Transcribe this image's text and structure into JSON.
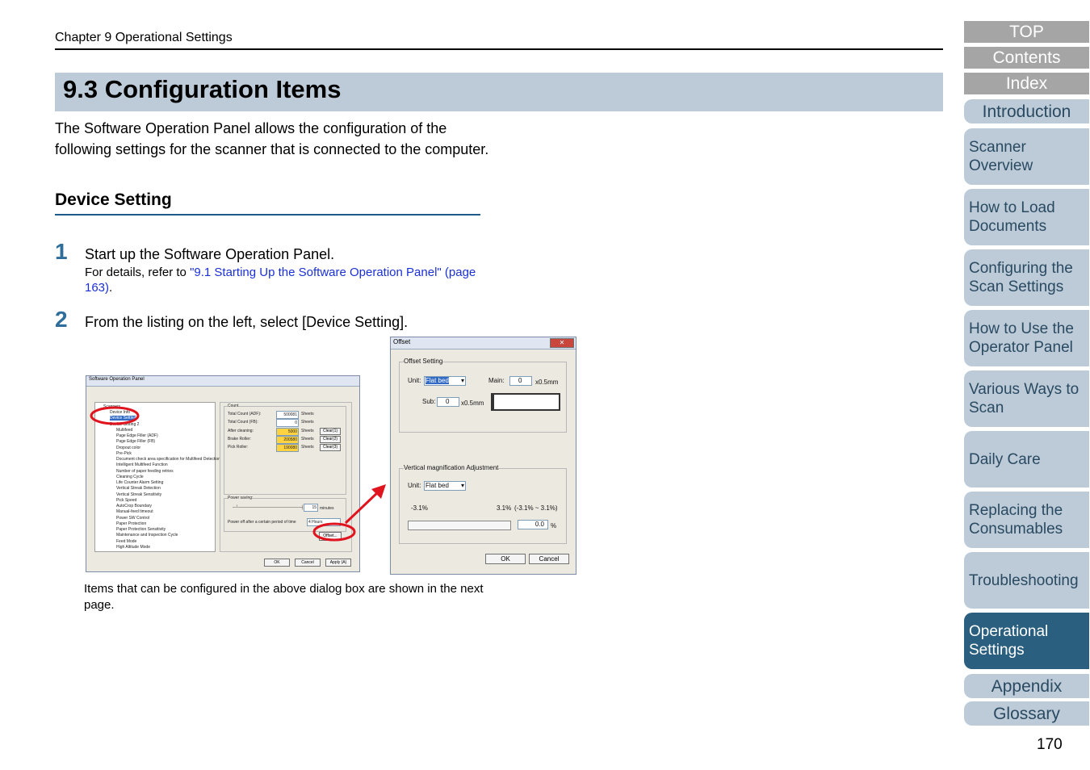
{
  "header": {
    "chapter": "Chapter 9 Operational Settings"
  },
  "title": "9.3 Configuration Items",
  "intro": "The Software Operation Panel allows the configuration of the following settings for the scanner that is connected to the computer.",
  "section": "Device Setting",
  "steps": [
    {
      "num": "1",
      "text": "Start up the Software Operation Panel.",
      "sub_prefix": "For details, refer to ",
      "sub_link": "\"9.1 Starting Up the Software Operation Panel\" (page 163)",
      "sub_suffix": "."
    },
    {
      "num": "2",
      "text": "From the listing on the left, select [Device Setting]."
    }
  ],
  "caption": "Items that can be configured in the above dialog box are shown in the next page.",
  "page_number": "170",
  "sidebar": {
    "top": "TOP",
    "contents": "Contents",
    "index": "Index",
    "tabs": [
      "Introduction",
      "Scanner Overview",
      "How to Load Documents",
      "Configuring the Scan Settings",
      "How to Use the Operator Panel",
      "Various Ways to Scan",
      "Daily Care",
      "Replacing the Consumables",
      "Troubleshooting",
      "Operational Settings",
      "Appendix",
      "Glossary"
    ]
  },
  "dialog1": {
    "title": "Software Operation Panel",
    "tree": [
      "Device Info",
      "Device Setting",
      "Device Setting 2",
      "Multifeed",
      "Page Edge Filler (ADF)",
      "Page Edge Filler (FB)",
      "Dropout color",
      "Pre-Pick",
      "Document check area specification for Multifeed Detection",
      "Intelligent Multifeed Function",
      "Number of paper feeding retries",
      "Cleaning Cycle",
      "Life Counter Alarm Setting",
      "Vertical Streak Detection",
      "Vertical Streak Sensitivity",
      "Pick Speed",
      "AutoCrop Boundary",
      "Manual-feed timeout",
      "Power SW Control",
      "Paper Protection",
      "Paper Protection Sensitivity",
      "Maintenance and Inspection Cycle",
      "Feed Mode",
      "High Altitude Mode"
    ],
    "tree_root": "Scanners",
    "count_group": "Count",
    "counts": [
      {
        "label": "Total Count (ADF):",
        "value": "500081",
        "unit": "Sheets",
        "clear": ""
      },
      {
        "label": "Total Count (FB):",
        "value": "0",
        "unit": "Sheets",
        "clear": ""
      },
      {
        "label": "After cleaning:",
        "value": "5000",
        "unit": "Sheets",
        "clear": "Clear(1)"
      },
      {
        "label": "Brake Roller:",
        "value": "200580",
        "unit": "Sheets",
        "clear": "Clear(2)"
      },
      {
        "label": "Pick Roller:",
        "value": "190080",
        "unit": "Sheets",
        "clear": "Clear(3)"
      }
    ],
    "power_group": "Power saving:",
    "power_minutes": "15",
    "power_unit": "minutes",
    "power_off_label": "Power off after a certain period of time",
    "power_off_value": "4 Hours",
    "offset_button": "Offset...",
    "ok": "OK",
    "cancel": "Cancel",
    "apply": "Apply (A)"
  },
  "dialog2": {
    "title": "Offset",
    "offset_group": "Offset Setting",
    "unit_label": "Unit:",
    "unit_value": "Flat bed",
    "main_label": "Main:",
    "main_value": "0",
    "main_unit": "x0.5mm",
    "sub_label": "Sub:",
    "sub_value": "0",
    "sub_unit": "x0.5mm",
    "vma_group": "Vertical magnification Adjustment",
    "vma_unit_value": "Flat bed",
    "range_min": "-3.1%",
    "range_max": "3.1%",
    "range_text": "(-3.1% ~ 3.1%)",
    "vma_value": "0.0",
    "vma_pct": "%",
    "ok": "OK",
    "cancel": "Cancel"
  },
  "colors": {
    "title_bar": "#bccbd7",
    "accent": "#2a5f80",
    "link": "#1a30d6",
    "highlight": "#e0141e"
  }
}
